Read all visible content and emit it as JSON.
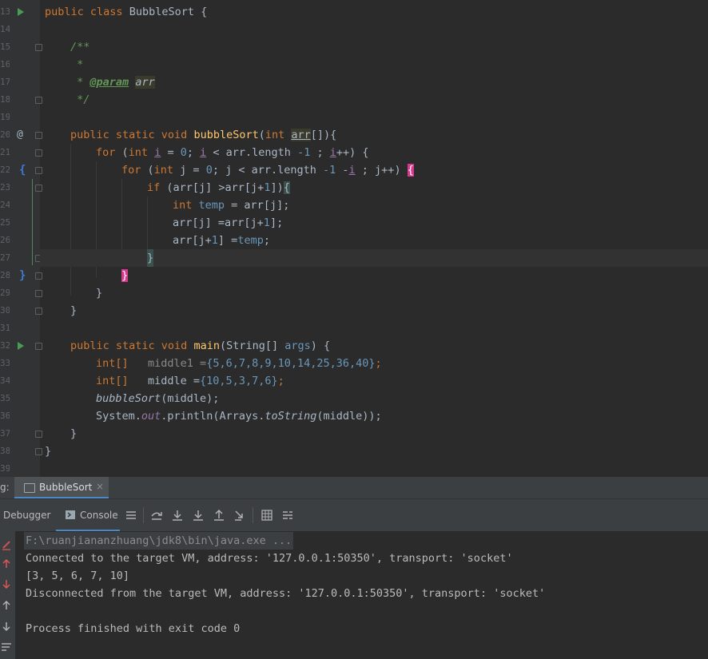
{
  "editor": {
    "line_numbers": [
      "13",
      "14",
      "15",
      "16",
      "17",
      "18",
      "19",
      "20",
      "21",
      "22",
      "23",
      "24",
      "25",
      "26",
      "27",
      "28",
      "29",
      "30",
      "31",
      "32",
      "33",
      "34",
      "35",
      "36",
      "37",
      "38",
      "39"
    ],
    "code": {
      "l13": {
        "kw": "public class",
        "name": "BubbleSort",
        "rest": " {"
      },
      "l15": "/**",
      "l16": " *",
      "l17_star": " * ",
      "l17_tag": "@param",
      "l17_name": "arr",
      "l18": " */",
      "l20_kw": "public static void",
      "l20_fn": "bubbleSort",
      "l20_p1": "(",
      "l20_type": "int",
      "l20_arg": "arr",
      "l20_p2": "[]){",
      "l21_kw": "for",
      "l21_a": " (",
      "l21_int": "int",
      "l21_i": "i",
      "l21_b": " = ",
      "l21_zero": "0",
      "l21_c": "; ",
      "l21_i2": "i",
      "l21_d": " < arr.length ",
      "l21_m1": "-1",
      "l21_e": " ; ",
      "l21_i3": "i",
      "l21_f": "++) {",
      "l22_kw": "for",
      "l22_a": " (",
      "l22_int": "int",
      "l22_b": " j = ",
      "l22_zero": "0",
      "l22_c": "; j < arr.length ",
      "l22_m1": "-1",
      "l22_d": " -",
      "l22_i": "i",
      "l22_e": " ; j++) ",
      "l22_brace": "{",
      "l23_kw": "if",
      "l23_a": " (arr[j] >arr[j+",
      "l23_one": "1",
      "l23_b": "])",
      "l23_brace": "{",
      "l24_int": "int",
      "l24_var": "temp",
      "l24_rest": " = arr[j];",
      "l25": "arr[j] =arr[j+",
      "l25_one": "1",
      "l25_end": "];",
      "l26_a": "arr[j+",
      "l26_one": "1",
      "l26_b": "] =",
      "l26_var": "temp",
      "l26_c": ";",
      "l27": "}",
      "l28": "}",
      "l29": "}",
      "l30": "}",
      "l32_kw": "public static void",
      "l32_fn": "main",
      "l32_a": "(String[] ",
      "l32_arg": "args",
      "l32_b": ") {",
      "l33_type": "int[]",
      "l33_a": "   middle1 =",
      "l33_vals": "{5,6,7,8,9,10,14,25,36,40}",
      "l33_b": ";",
      "l34_type": "int[]",
      "l34_a": "   middle =",
      "l34_vals": "{10,5,3,7,6}",
      "l34_b": ";",
      "l35_call": "bubbleSort",
      "l35_rest": "(middle);",
      "l36_a": "System.",
      "l36_out": "out",
      "l36_b": ".println(Arrays.",
      "l36_ts": "toString",
      "l36_c": "(middle));",
      "l37": "}",
      "l38": "}"
    }
  },
  "debug_tab": {
    "label_prefix": "g:",
    "tab_label": "BubbleSort",
    "close": "×"
  },
  "toolbar": {
    "debugger_label": "Debugger",
    "console_label": "Console"
  },
  "console": {
    "lines": [
      "F:\\ruanjiananzhuang\\jdk8\\bin\\java.exe ...",
      "Connected to the target VM, address: '127.0.0.1:50350', transport: 'socket'",
      "[3, 5, 6, 7, 10]",
      "Disconnected from the target VM, address: '127.0.0.1:50350', transport: 'socket'",
      "",
      "Process finished with exit code 0"
    ]
  },
  "colors": {
    "background": "#2b2b2b",
    "keyword": "#cc7832",
    "function": "#ffc66d",
    "number": "#6897bb",
    "comment": "#629755",
    "field": "#9876aa",
    "bracket_mark": "#d73a8c"
  }
}
